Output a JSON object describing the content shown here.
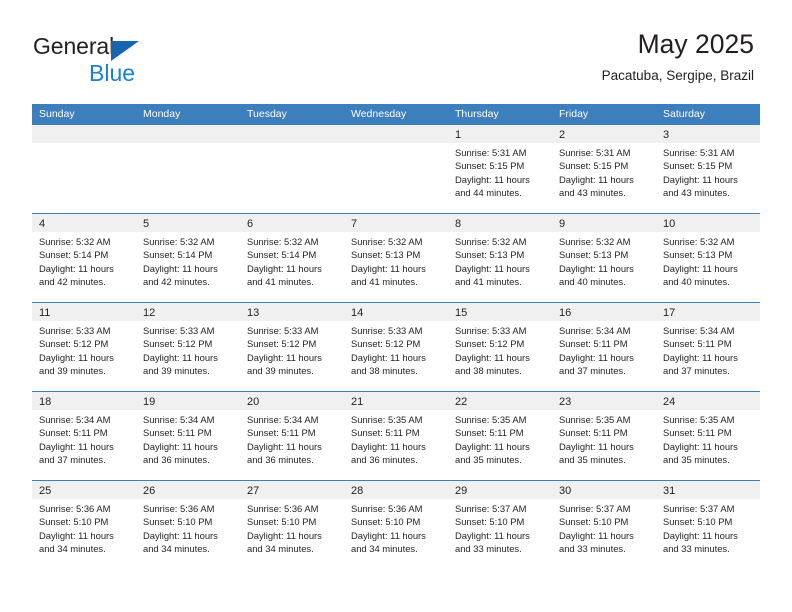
{
  "brand": {
    "word_one": "General",
    "word_two": "Blue",
    "triangle_color": "#1565b0",
    "blue_color": "#1b7fd4"
  },
  "header": {
    "title": "May 2025",
    "location": "Pacatuba, Sergipe, Brazil"
  },
  "theme": {
    "header_blue": "#3d7ebd",
    "band_gray": "#f0f0f0",
    "text": "#231f20"
  },
  "weekdays": [
    "Sunday",
    "Monday",
    "Tuesday",
    "Wednesday",
    "Thursday",
    "Friday",
    "Saturday"
  ],
  "weeks": [
    [
      {
        "day": "",
        "sunrise": "",
        "sunset": "",
        "daylight_1": "",
        "daylight_2": ""
      },
      {
        "day": "",
        "sunrise": "",
        "sunset": "",
        "daylight_1": "",
        "daylight_2": ""
      },
      {
        "day": "",
        "sunrise": "",
        "sunset": "",
        "daylight_1": "",
        "daylight_2": ""
      },
      {
        "day": "",
        "sunrise": "",
        "sunset": "",
        "daylight_1": "",
        "daylight_2": ""
      },
      {
        "day": "1",
        "sunrise": "Sunrise: 5:31 AM",
        "sunset": "Sunset: 5:15 PM",
        "daylight_1": "Daylight: 11 hours",
        "daylight_2": "and 44 minutes."
      },
      {
        "day": "2",
        "sunrise": "Sunrise: 5:31 AM",
        "sunset": "Sunset: 5:15 PM",
        "daylight_1": "Daylight: 11 hours",
        "daylight_2": "and 43 minutes."
      },
      {
        "day": "3",
        "sunrise": "Sunrise: 5:31 AM",
        "sunset": "Sunset: 5:15 PM",
        "daylight_1": "Daylight: 11 hours",
        "daylight_2": "and 43 minutes."
      }
    ],
    [
      {
        "day": "4",
        "sunrise": "Sunrise: 5:32 AM",
        "sunset": "Sunset: 5:14 PM",
        "daylight_1": "Daylight: 11 hours",
        "daylight_2": "and 42 minutes."
      },
      {
        "day": "5",
        "sunrise": "Sunrise: 5:32 AM",
        "sunset": "Sunset: 5:14 PM",
        "daylight_1": "Daylight: 11 hours",
        "daylight_2": "and 42 minutes."
      },
      {
        "day": "6",
        "sunrise": "Sunrise: 5:32 AM",
        "sunset": "Sunset: 5:14 PM",
        "daylight_1": "Daylight: 11 hours",
        "daylight_2": "and 41 minutes."
      },
      {
        "day": "7",
        "sunrise": "Sunrise: 5:32 AM",
        "sunset": "Sunset: 5:13 PM",
        "daylight_1": "Daylight: 11 hours",
        "daylight_2": "and 41 minutes."
      },
      {
        "day": "8",
        "sunrise": "Sunrise: 5:32 AM",
        "sunset": "Sunset: 5:13 PM",
        "daylight_1": "Daylight: 11 hours",
        "daylight_2": "and 41 minutes."
      },
      {
        "day": "9",
        "sunrise": "Sunrise: 5:32 AM",
        "sunset": "Sunset: 5:13 PM",
        "daylight_1": "Daylight: 11 hours",
        "daylight_2": "and 40 minutes."
      },
      {
        "day": "10",
        "sunrise": "Sunrise: 5:32 AM",
        "sunset": "Sunset: 5:13 PM",
        "daylight_1": "Daylight: 11 hours",
        "daylight_2": "and 40 minutes."
      }
    ],
    [
      {
        "day": "11",
        "sunrise": "Sunrise: 5:33 AM",
        "sunset": "Sunset: 5:12 PM",
        "daylight_1": "Daylight: 11 hours",
        "daylight_2": "and 39 minutes."
      },
      {
        "day": "12",
        "sunrise": "Sunrise: 5:33 AM",
        "sunset": "Sunset: 5:12 PM",
        "daylight_1": "Daylight: 11 hours",
        "daylight_2": "and 39 minutes."
      },
      {
        "day": "13",
        "sunrise": "Sunrise: 5:33 AM",
        "sunset": "Sunset: 5:12 PM",
        "daylight_1": "Daylight: 11 hours",
        "daylight_2": "and 39 minutes."
      },
      {
        "day": "14",
        "sunrise": "Sunrise: 5:33 AM",
        "sunset": "Sunset: 5:12 PM",
        "daylight_1": "Daylight: 11 hours",
        "daylight_2": "and 38 minutes."
      },
      {
        "day": "15",
        "sunrise": "Sunrise: 5:33 AM",
        "sunset": "Sunset: 5:12 PM",
        "daylight_1": "Daylight: 11 hours",
        "daylight_2": "and 38 minutes."
      },
      {
        "day": "16",
        "sunrise": "Sunrise: 5:34 AM",
        "sunset": "Sunset: 5:11 PM",
        "daylight_1": "Daylight: 11 hours",
        "daylight_2": "and 37 minutes."
      },
      {
        "day": "17",
        "sunrise": "Sunrise: 5:34 AM",
        "sunset": "Sunset: 5:11 PM",
        "daylight_1": "Daylight: 11 hours",
        "daylight_2": "and 37 minutes."
      }
    ],
    [
      {
        "day": "18",
        "sunrise": "Sunrise: 5:34 AM",
        "sunset": "Sunset: 5:11 PM",
        "daylight_1": "Daylight: 11 hours",
        "daylight_2": "and 37 minutes."
      },
      {
        "day": "19",
        "sunrise": "Sunrise: 5:34 AM",
        "sunset": "Sunset: 5:11 PM",
        "daylight_1": "Daylight: 11 hours",
        "daylight_2": "and 36 minutes."
      },
      {
        "day": "20",
        "sunrise": "Sunrise: 5:34 AM",
        "sunset": "Sunset: 5:11 PM",
        "daylight_1": "Daylight: 11 hours",
        "daylight_2": "and 36 minutes."
      },
      {
        "day": "21",
        "sunrise": "Sunrise: 5:35 AM",
        "sunset": "Sunset: 5:11 PM",
        "daylight_1": "Daylight: 11 hours",
        "daylight_2": "and 36 minutes."
      },
      {
        "day": "22",
        "sunrise": "Sunrise: 5:35 AM",
        "sunset": "Sunset: 5:11 PM",
        "daylight_1": "Daylight: 11 hours",
        "daylight_2": "and 35 minutes."
      },
      {
        "day": "23",
        "sunrise": "Sunrise: 5:35 AM",
        "sunset": "Sunset: 5:11 PM",
        "daylight_1": "Daylight: 11 hours",
        "daylight_2": "and 35 minutes."
      },
      {
        "day": "24",
        "sunrise": "Sunrise: 5:35 AM",
        "sunset": "Sunset: 5:11 PM",
        "daylight_1": "Daylight: 11 hours",
        "daylight_2": "and 35 minutes."
      }
    ],
    [
      {
        "day": "25",
        "sunrise": "Sunrise: 5:36 AM",
        "sunset": "Sunset: 5:10 PM",
        "daylight_1": "Daylight: 11 hours",
        "daylight_2": "and 34 minutes."
      },
      {
        "day": "26",
        "sunrise": "Sunrise: 5:36 AM",
        "sunset": "Sunset: 5:10 PM",
        "daylight_1": "Daylight: 11 hours",
        "daylight_2": "and 34 minutes."
      },
      {
        "day": "27",
        "sunrise": "Sunrise: 5:36 AM",
        "sunset": "Sunset: 5:10 PM",
        "daylight_1": "Daylight: 11 hours",
        "daylight_2": "and 34 minutes."
      },
      {
        "day": "28",
        "sunrise": "Sunrise: 5:36 AM",
        "sunset": "Sunset: 5:10 PM",
        "daylight_1": "Daylight: 11 hours",
        "daylight_2": "and 34 minutes."
      },
      {
        "day": "29",
        "sunrise": "Sunrise: 5:37 AM",
        "sunset": "Sunset: 5:10 PM",
        "daylight_1": "Daylight: 11 hours",
        "daylight_2": "and 33 minutes."
      },
      {
        "day": "30",
        "sunrise": "Sunrise: 5:37 AM",
        "sunset": "Sunset: 5:10 PM",
        "daylight_1": "Daylight: 11 hours",
        "daylight_2": "and 33 minutes."
      },
      {
        "day": "31",
        "sunrise": "Sunrise: 5:37 AM",
        "sunset": "Sunset: 5:10 PM",
        "daylight_1": "Daylight: 11 hours",
        "daylight_2": "and 33 minutes."
      }
    ]
  ]
}
